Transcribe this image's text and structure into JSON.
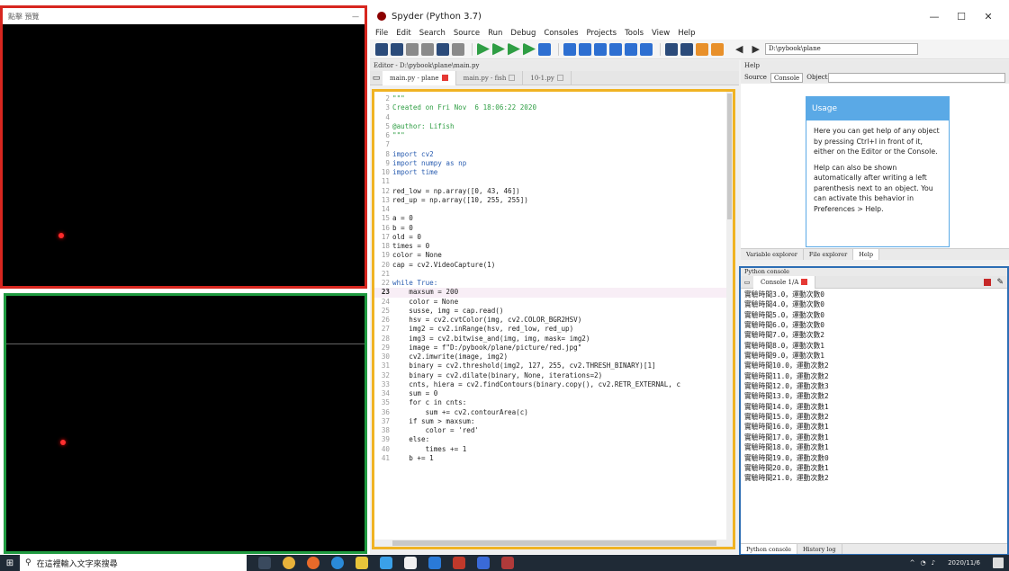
{
  "cam1": {
    "title": "點擊 預覽"
  },
  "spyder": {
    "title": "Spyder (Python 3.7)",
    "menu": [
      "File",
      "Edit",
      "Search",
      "Source",
      "Run",
      "Debug",
      "Consoles",
      "Projects",
      "Tools",
      "View",
      "Help"
    ],
    "path": "D:\\pybook\\plane",
    "editor_title": "Editor - D:\\pybook\\plane\\main.py",
    "help_title": "Help",
    "tabs": [
      {
        "label": "main.py - plane"
      },
      {
        "label": "main.py - fish"
      },
      {
        "label": "10-1.py"
      }
    ],
    "help": {
      "source_label": "Source",
      "source_value": "Console",
      "object_label": "Object",
      "usage_title": "Usage",
      "usage_p1": "Here you can get help of any object by pressing Ctrl+I in front of it, either on the Editor or the Console.",
      "usage_p2": "Help can also be shown automatically after writing a left parenthesis next to an object. You can activate this behavior in Preferences > Help.",
      "tabs": [
        "Variable explorer",
        "File explorer",
        "Help"
      ]
    },
    "console": {
      "pane_title": "Python console",
      "tab_label": "Console 1/A",
      "bottom_tabs": [
        "Python console",
        "History log"
      ],
      "lines": [
        "實驗時間3.0，運動次數0",
        "實驗時間4.0，運動次數0",
        "實驗時間5.0，運動次數0",
        "實驗時間6.0，運動次數0",
        "實驗時間7.0，運動次數2",
        "實驗時間8.0，運動次數1",
        "實驗時間9.0，運動次數1",
        "實驗時間10.0，運動次數2",
        "實驗時間11.0，運動次數2",
        "實驗時間12.0，運動次數3",
        "實驗時間13.0，運動次數2",
        "實驗時間14.0，運動次數1",
        "實驗時間15.0，運動次數2",
        "實驗時間16.0，運動次數1",
        "實驗時間17.0，運動次數1",
        "實驗時間18.0，運動次數1",
        "實驗時間19.0，運動次數0",
        "實驗時間20.0，運動次數1",
        "實驗時間21.0，運動次數2"
      ]
    }
  },
  "code_lines": [
    {
      "no": "2",
      "text": "\"\"\"",
      "cls": "c-doc"
    },
    {
      "no": "3",
      "text": "Created on Fri Nov  6 18:06:22 2020",
      "cls": "c-doc"
    },
    {
      "no": "4",
      "text": "",
      "cls": ""
    },
    {
      "no": "5",
      "text": "@author: Lifish",
      "cls": "c-doc"
    },
    {
      "no": "6",
      "text": "\"\"\"",
      "cls": "c-doc"
    },
    {
      "no": "7",
      "text": "",
      "cls": ""
    },
    {
      "no": "8",
      "text": "import cv2",
      "cls": "c-kw"
    },
    {
      "no": "9",
      "text": "import numpy as np",
      "cls": "c-kw"
    },
    {
      "no": "10",
      "text": "import time",
      "cls": "c-kw"
    },
    {
      "no": "11",
      "text": "",
      "cls": ""
    },
    {
      "no": "12",
      "text": "red_low = np.array([0, 43, 46])",
      "cls": ""
    },
    {
      "no": "13",
      "text": "red_up = np.array([10, 255, 255])",
      "cls": ""
    },
    {
      "no": "14",
      "text": "",
      "cls": ""
    },
    {
      "no": "15",
      "text": "a = 0",
      "cls": ""
    },
    {
      "no": "16",
      "text": "b = 0",
      "cls": ""
    },
    {
      "no": "17",
      "text": "old = 0",
      "cls": ""
    },
    {
      "no": "18",
      "text": "times = 0",
      "cls": ""
    },
    {
      "no": "19",
      "text": "color = None",
      "cls": ""
    },
    {
      "no": "20",
      "text": "cap = cv2.VideoCapture(1)",
      "cls": ""
    },
    {
      "no": "21",
      "text": "",
      "cls": ""
    },
    {
      "no": "22",
      "text": "while True:",
      "cls": "c-kw"
    },
    {
      "no": "23",
      "text": "    maxsum = 200",
      "cls": "",
      "cur": true
    },
    {
      "no": "24",
      "text": "    color = None",
      "cls": ""
    },
    {
      "no": "25",
      "text": "    susse, img = cap.read()",
      "cls": ""
    },
    {
      "no": "26",
      "text": "    hsv = cv2.cvtColor(img, cv2.COLOR_BGR2HSV)",
      "cls": ""
    },
    {
      "no": "27",
      "text": "    img2 = cv2.inRange(hsv, red_low, red_up)",
      "cls": ""
    },
    {
      "no": "28",
      "text": "    img3 = cv2.bitwise_and(img, img, mask= img2)",
      "cls": ""
    },
    {
      "no": "29",
      "text": "    image = f\"D:/pybook/plane/picture/red.jpg\"",
      "cls": ""
    },
    {
      "no": "30",
      "text": "    cv2.imwrite(image, img2)",
      "cls": ""
    },
    {
      "no": "31",
      "text": "    binary = cv2.threshold(img2, 127, 255, cv2.THRESH_BINARY)[1]",
      "cls": ""
    },
    {
      "no": "32",
      "text": "    binary = cv2.dilate(binary, None, iterations=2)",
      "cls": ""
    },
    {
      "no": "33",
      "text": "    cnts, hiera = cv2.findContours(binary.copy(), cv2.RETR_EXTERNAL, c",
      "cls": ""
    },
    {
      "no": "34",
      "text": "    sum = 0",
      "cls": ""
    },
    {
      "no": "35",
      "text": "    for c in cnts:",
      "cls": ""
    },
    {
      "no": "36",
      "text": "        sum += cv2.contourArea(c)",
      "cls": ""
    },
    {
      "no": "37",
      "text": "    if sum > maxsum:",
      "cls": ""
    },
    {
      "no": "38",
      "text": "        color = 'red'",
      "cls": ""
    },
    {
      "no": "39",
      "text": "    else:",
      "cls": ""
    },
    {
      "no": "40",
      "text": "        times += 1",
      "cls": ""
    },
    {
      "no": "41",
      "text": "    b += 1",
      "cls": ""
    }
  ],
  "taskbar": {
    "search_placeholder": "在這裡輸入文字來搜尋",
    "date": "2020/11/6"
  }
}
